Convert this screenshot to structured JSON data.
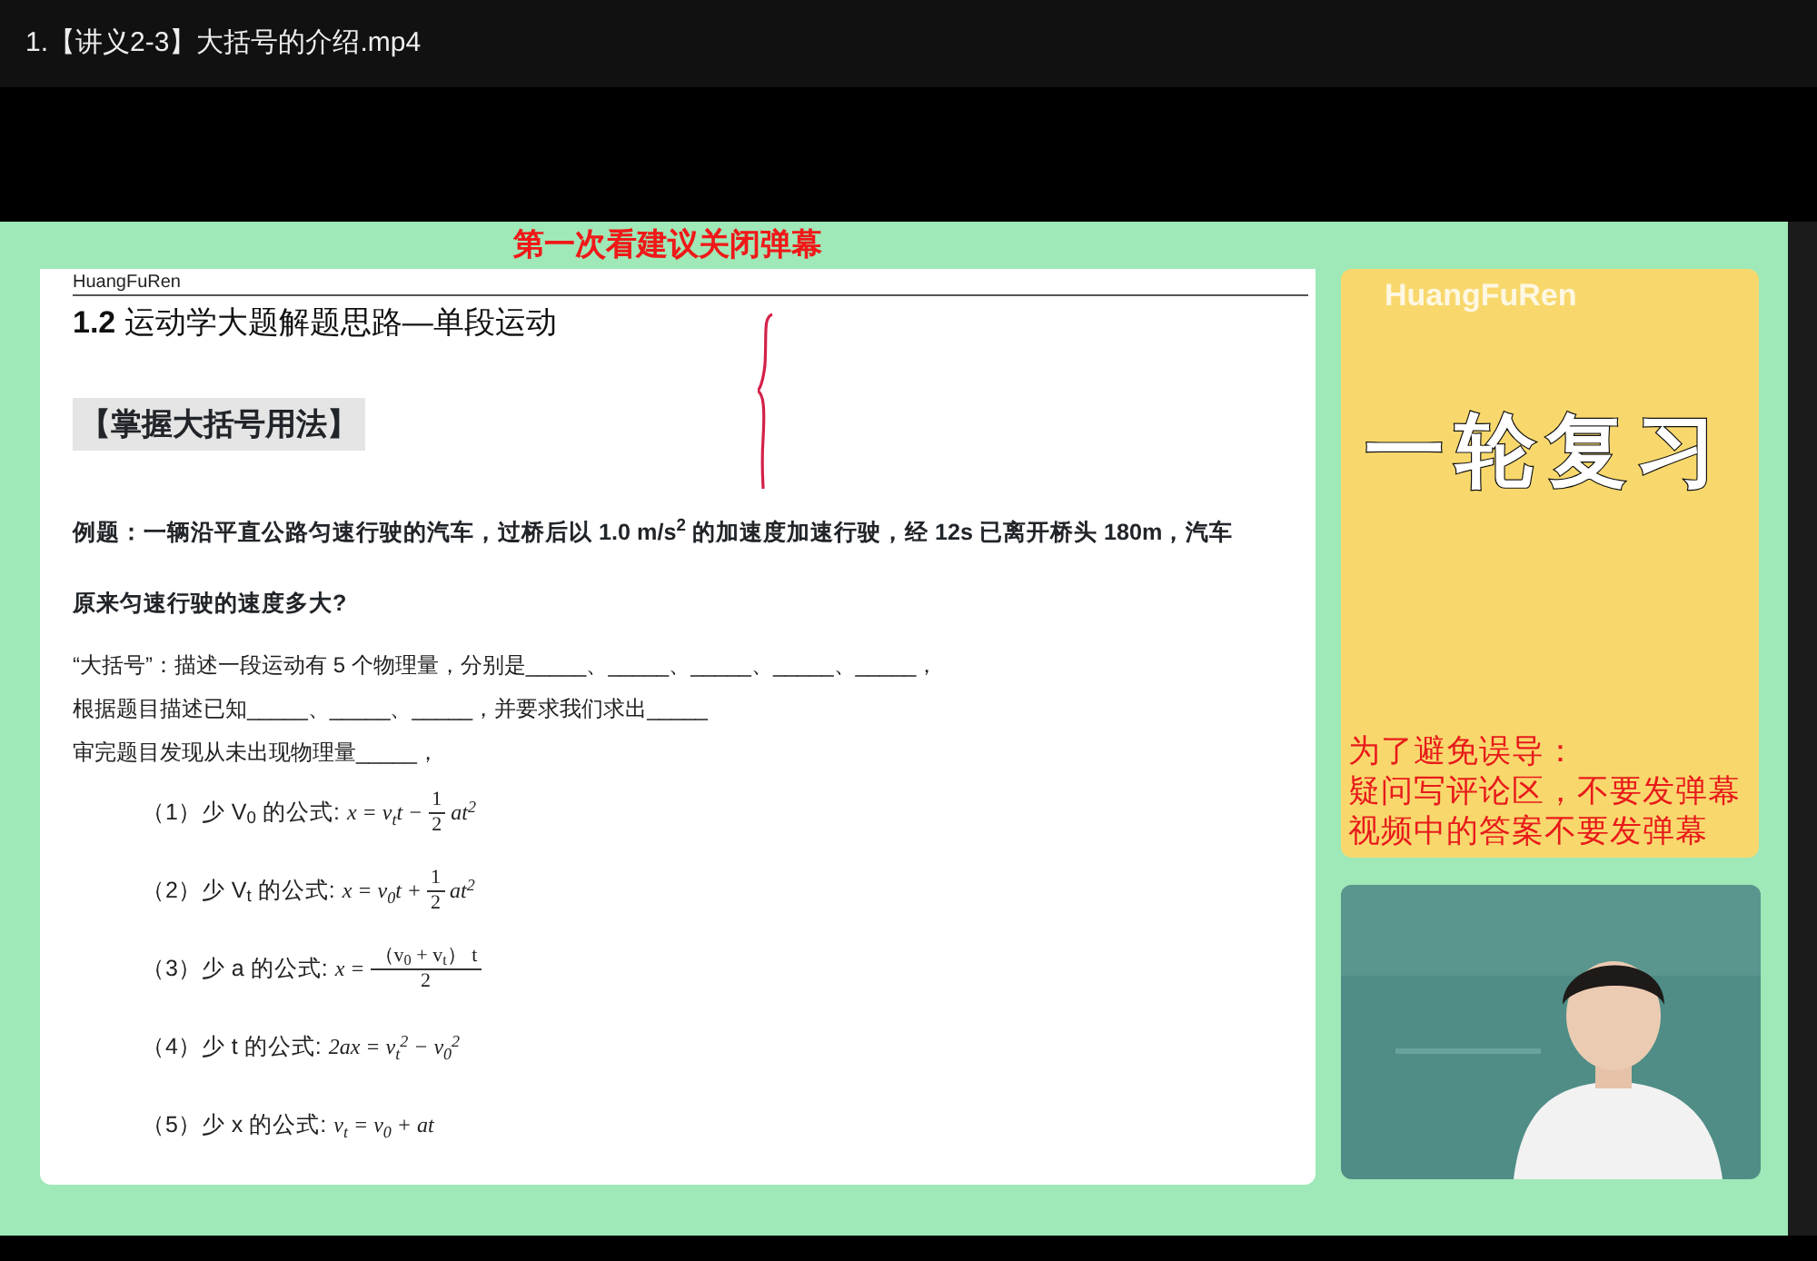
{
  "window": {
    "title": "1.【讲义2-3】大括号的介绍.mp4"
  },
  "video": {
    "danmaku": "第一次看建议关闭弹幕",
    "slide": {
      "header": "HuangFuRen",
      "title": "**1.2** 运动学大题解题思路—单段运动",
      "section": "【掌握大括号用法】",
      "example": "例题：一辆沿平直公路匀速行驶的汽车，过桥后以 1.0 m/s$^{2}$ 的加速度加速行驶，经 12s 已离开桥头 180m，汽车",
      "question": "原来匀速行驶的速度多大?",
      "lines": [
        "“大括号”：描述一段运动有 5 个物理量，分别是_____、_____、_____、_____、_____，",
        "根据题目描述已知_____、_____、_____，并要求我们求出_____",
        "审完题目发现从未出现物理量_____，"
      ],
      "formulas": [
        {
          "label": "（1）少 V$_{0}$ 的公式:",
          "lhs": "x = v$_{t}$t −",
          "frac": [
            "1",
            "2"
          ],
          "rhs": "at$^{2}$"
        },
        {
          "label": "（2）少 V$_{t}$ 的公式:",
          "lhs": "x = v$_{0}$t +",
          "frac": [
            "1",
            "2"
          ],
          "rhs": "at$^{2}$"
        },
        {
          "label": "（3）少 a 的公式:",
          "lhs": "x =",
          "frac": [
            "（v$_{0}$ + v$_{t}$） t",
            "2"
          ]
        },
        {
          "label": "（4）少 t 的公式:",
          "lhs": "2ax = v$_{t}$$^{2}$ − v$_{0}$$^{2}$"
        },
        {
          "label": "（5）少 x 的公式:",
          "lhs": "v$_{t}$ = v$_{0}$ + at"
        }
      ]
    },
    "side_panel": {
      "watermark": "HuangFuRen",
      "headline": "一轮复习",
      "notes": [
        "为了避免误导：",
        "疑问写评论区，不要发弹幕",
        "视频中的答案不要发弹幕"
      ]
    }
  }
}
